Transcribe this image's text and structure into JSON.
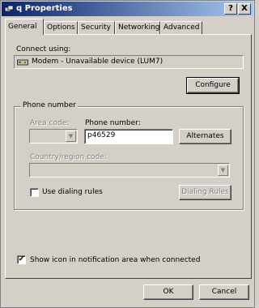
{
  "window": {
    "title": "q Properties",
    "help_button": "?",
    "close_button": "X"
  },
  "tabs": [
    "General",
    "Options",
    "Security",
    "Networking",
    "Advanced"
  ],
  "general": {
    "connect_using_label": "Connect using:",
    "device_name": "Modem - Unavailable device (LUM7)",
    "configure_button": "Configure",
    "phone_group_label": "Phone number",
    "area_code_label": "Area code:",
    "area_code_value": "",
    "phone_number_label": "Phone number:",
    "phone_number_value": "p46529",
    "alternates_button": "Alternates",
    "country_label": "Country/region code:",
    "country_value": "",
    "use_dialing_rules_label": "Use dialing rules",
    "use_dialing_rules_checked": false,
    "dialing_rules_button": "Dialing Rules",
    "show_icon_label": "Show icon in notification area when connected",
    "show_icon_checked": true
  },
  "footer": {
    "ok_button": "OK",
    "cancel_button": "Cancel"
  },
  "colors": {
    "face": "#d4d0c8",
    "title_start": "#0a246a",
    "title_end": "#a6caf0"
  }
}
